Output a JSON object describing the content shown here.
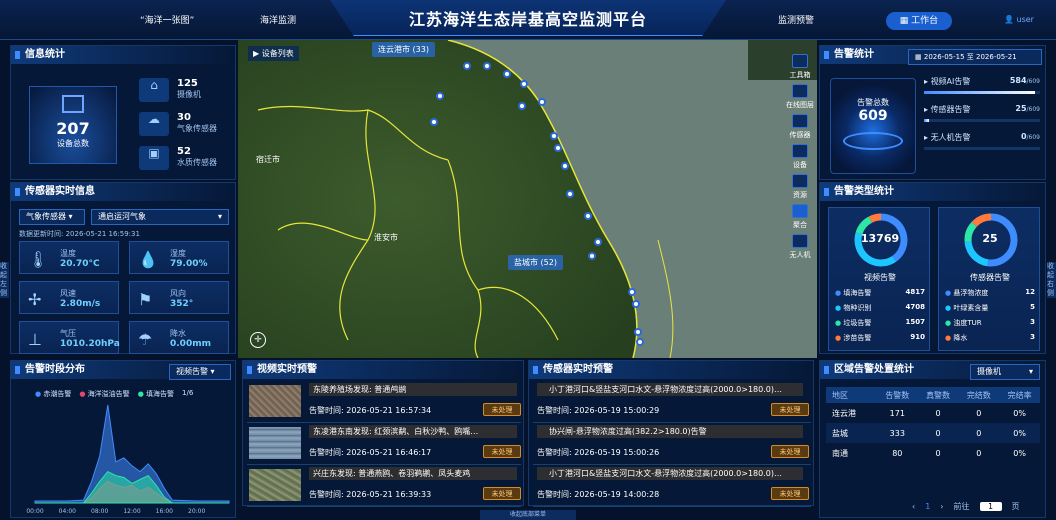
{
  "header": {
    "title": "江苏海洋生态岸基高空监测平台",
    "nav_left": "“海洋一张图”",
    "nav_mid": "海洋监测",
    "nav_right": "监测预警",
    "work_btn": "工作台",
    "user": "user"
  },
  "info_stats": {
    "title": "信息统计",
    "total_value": "207",
    "total_label": "设备总数",
    "items": [
      {
        "value": "125",
        "label": "摄像机",
        "icon": "camera-icon"
      },
      {
        "value": "30",
        "label": "气象传感器",
        "icon": "cloud-icon"
      },
      {
        "value": "52",
        "label": "水质传感器",
        "icon": "water-sensor-icon"
      }
    ]
  },
  "sensor_rt": {
    "title": "传感器实时信息",
    "type_select": "气象传感器",
    "site_select": "通启运河气象",
    "update_label": "数据更新时间:",
    "update_time": "2026-05-21 16:59:31",
    "cells": [
      {
        "label": "温度",
        "value": "20.70°C",
        "icon": "thermometer-icon"
      },
      {
        "label": "湿度",
        "value": "79.00%",
        "icon": "droplet-icon"
      },
      {
        "label": "风速",
        "value": "2.80m/s",
        "icon": "fan-icon"
      },
      {
        "label": "风向",
        "value": "352°",
        "icon": "wind-vane-icon"
      },
      {
        "label": "气压",
        "value": "1010.20hPa",
        "icon": "pressure-icon"
      },
      {
        "label": "降水",
        "value": "0.00mm",
        "icon": "rain-icon"
      }
    ]
  },
  "time_dist": {
    "title": "告警时段分布",
    "select": "视频告警",
    "page": "1/6",
    "legend": [
      "赤潮告警",
      "海洋溢油告警",
      "填海告警"
    ]
  },
  "map": {
    "device_list": "设备列表",
    "cluster_lyg": "连云港市 (33)",
    "cluster_yc": "盐城市 (52)",
    "label_sq": "宿迁市",
    "label_ha": "淮安市",
    "tools": [
      "工具箱",
      "在线图层",
      "传感器",
      "设备",
      "资源",
      "聚合",
      "无人机"
    ],
    "side_left": "收起左侧",
    "side_right": "收起右侧",
    "bottom_toggle": "收起底部菜单"
  },
  "video_alerts": {
    "title": "视频实时预警",
    "time_label": "告警时间:",
    "status": "未处理",
    "items": [
      {
        "title": "东陵养殖场发现: 普通鸬鹚",
        "time": "2026-05-21 16:57:34"
      },
      {
        "title": "东凌港东南发现: 红颈滨鹬、白秋沙鸭、鸥嘴…",
        "time": "2026-05-21 16:46:17"
      },
      {
        "title": "兴庄东发现: 普通燕鸥、卷羽鹈鹕、凤头麦鸡",
        "time": "2026-05-21 16:39:33"
      }
    ]
  },
  "sensor_alerts": {
    "title": "传感器实时预警",
    "time_label": "告警时间:",
    "status": "未处理",
    "items": [
      {
        "title": "小丁港河口&竖盐支河口水文-悬浮物浓度过高(2000.0>180.0)…",
        "time": "2026-05-19 15:00:29"
      },
      {
        "title": "协兴闸-悬浮物浓度过高(382.2>180.0)告警",
        "time": "2026-05-19 15:00:26"
      },
      {
        "title": "小丁港河口&竖盐支河口水文-悬浮物浓度过高(2000.0>180.0)…",
        "time": "2026-05-19 14:00:28"
      }
    ]
  },
  "alarm_stats": {
    "title": "告警统计",
    "date_from": "2026-05-15",
    "date_sep": "至",
    "date_to": "2026-05-21",
    "total_label": "告警总数",
    "total_value": "609",
    "rows": [
      {
        "label": "视频AI告警",
        "value": "584",
        "total": "/609",
        "fraction": 0.96
      },
      {
        "label": "传感器告警",
        "value": "25",
        "total": "/609",
        "fraction": 0.04
      },
      {
        "label": "无人机告警",
        "value": "0",
        "total": "/609",
        "fraction": 0
      }
    ]
  },
  "type_stats": {
    "title": "告警类型统计",
    "video": {
      "total": "13769",
      "label": "视频告警",
      "items": [
        {
          "name": "填海告警",
          "value": "4817",
          "color": "#3f8cff"
        },
        {
          "name": "物种识别",
          "value": "4708",
          "color": "#1ec6ff"
        },
        {
          "name": "垃圾告警",
          "value": "1507",
          "color": "#2ee6a6"
        },
        {
          "name": "涉苗告警",
          "value": "910",
          "color": "#ff7a3c"
        }
      ]
    },
    "sensor": {
      "total": "25",
      "label": "传感器告警",
      "items": [
        {
          "name": "悬浮物浓度",
          "value": "12",
          "color": "#3f8cff"
        },
        {
          "name": "叶绿素含量",
          "value": "5",
          "color": "#1ec6ff"
        },
        {
          "name": "浊度TUR",
          "value": "3",
          "color": "#2ee6a6"
        },
        {
          "name": "降水",
          "value": "3",
          "color": "#ff7a3c"
        }
      ]
    }
  },
  "region_stats": {
    "title": "区域告警处置统计",
    "select": "摄像机",
    "headers": [
      "地区",
      "告警数",
      "真警数",
      "完结数",
      "完结率"
    ],
    "rows": [
      [
        "连云港",
        "171",
        "0",
        "0",
        "0%"
      ],
      [
        "盐城",
        "333",
        "0",
        "0",
        "0%"
      ],
      [
        "南通",
        "80",
        "0",
        "0",
        "0%"
      ]
    ],
    "pager": {
      "prev": "‹",
      "page": "1",
      "next": "›",
      "goto": "前往",
      "input": "1",
      "unit": "页"
    }
  },
  "colors": {
    "accent": "#3f8cff",
    "warn": "#d68a28"
  },
  "chart_data": {
    "type": "area",
    "title": "告警时段分布",
    "x": [
      "00:00",
      "04:00",
      "08:00",
      "12:00",
      "16:00",
      "20:00"
    ],
    "xlim": [
      0,
      24
    ],
    "ylim": [
      0,
      10
    ],
    "series": [
      {
        "name": "赤潮告警",
        "color": "#3f8cff",
        "points": [
          [
            0,
            0.2
          ],
          [
            4,
            0.2
          ],
          [
            6,
            0.3
          ],
          [
            7,
            2.2
          ],
          [
            8,
            4.8
          ],
          [
            9,
            10
          ],
          [
            10,
            4.2
          ],
          [
            11,
            4.6
          ],
          [
            12,
            3.8
          ],
          [
            13,
            3.2
          ],
          [
            14,
            4.0
          ],
          [
            15,
            3.0
          ],
          [
            16,
            1.5
          ],
          [
            17,
            0.3
          ],
          [
            20,
            0.2
          ],
          [
            24,
            0.2
          ]
        ]
      },
      {
        "name": "海洋溢油告警",
        "color": "#e8456b",
        "points": [
          [
            0,
            0
          ],
          [
            6,
            0
          ],
          [
            7,
            0.5
          ],
          [
            8,
            1.5
          ],
          [
            9,
            2.2
          ],
          [
            10,
            1.8
          ],
          [
            11,
            1.6
          ],
          [
            12,
            1.8
          ],
          [
            13,
            1.2
          ],
          [
            14,
            1.6
          ],
          [
            15,
            1.0
          ],
          [
            16,
            0.4
          ],
          [
            17,
            0
          ],
          [
            24,
            0
          ]
        ]
      },
      {
        "name": "填海告警",
        "color": "#2ee6a6",
        "points": [
          [
            0,
            0
          ],
          [
            6,
            0
          ],
          [
            7,
            1.0
          ],
          [
            8,
            2.2
          ],
          [
            9,
            3.2
          ],
          [
            10,
            2.8
          ],
          [
            11,
            2.6
          ],
          [
            12,
            2.0
          ],
          [
            13,
            2.4
          ],
          [
            14,
            2.8
          ],
          [
            15,
            1.8
          ],
          [
            16,
            0.6
          ],
          [
            17,
            0
          ],
          [
            24,
            0
          ]
        ]
      }
    ]
  }
}
